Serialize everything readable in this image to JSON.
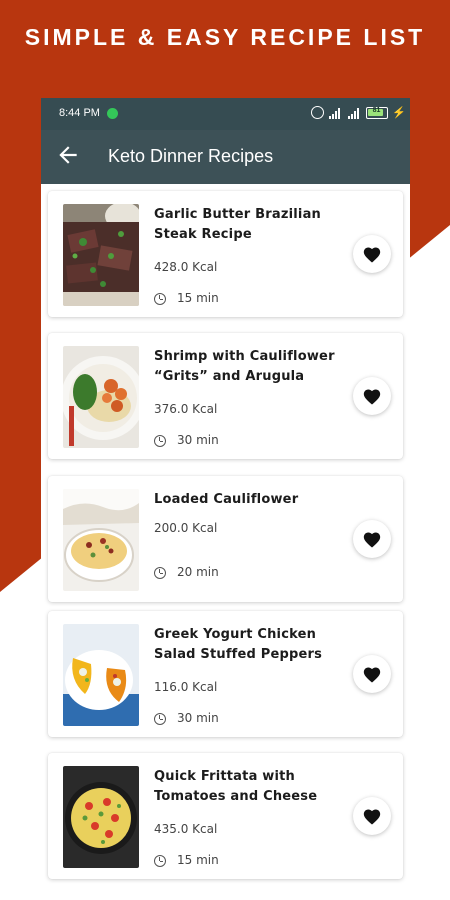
{
  "banner": {
    "title": "SIMPLE & EASY RECIPE LIST"
  },
  "status_bar": {
    "time": "8:44 PM",
    "battery": "81"
  },
  "app_bar": {
    "title": "Keto Dinner Recipes",
    "back_icon": "back-arrow-icon"
  },
  "colors": {
    "background_accent": "#b8360f",
    "toolbar": "#3d5157",
    "status_bar": "#364c52"
  },
  "recipes": [
    {
      "title": "Garlic Butter Brazilian Steak Recipe",
      "kcal": "428.0 Kcal",
      "time": "15 min",
      "favorite_icon": "heart-icon"
    },
    {
      "title": "Shrimp with Cauliflower “Grits” and Arugula",
      "kcal": "376.0 Kcal",
      "time": "30 min",
      "favorite_icon": "heart-icon"
    },
    {
      "title": "Loaded Cauliflower",
      "kcal": "200.0 Kcal",
      "time": "20 min",
      "favorite_icon": "heart-icon"
    },
    {
      "title": "Greek Yogurt Chicken Salad Stuffed Peppers",
      "kcal": "116.0 Kcal",
      "time": "30 min",
      "favorite_icon": "heart-icon"
    },
    {
      "title": "Quick Frittata with Tomatoes and Cheese",
      "kcal": "435.0 Kcal",
      "time": "15 min",
      "favorite_icon": "heart-icon"
    }
  ]
}
